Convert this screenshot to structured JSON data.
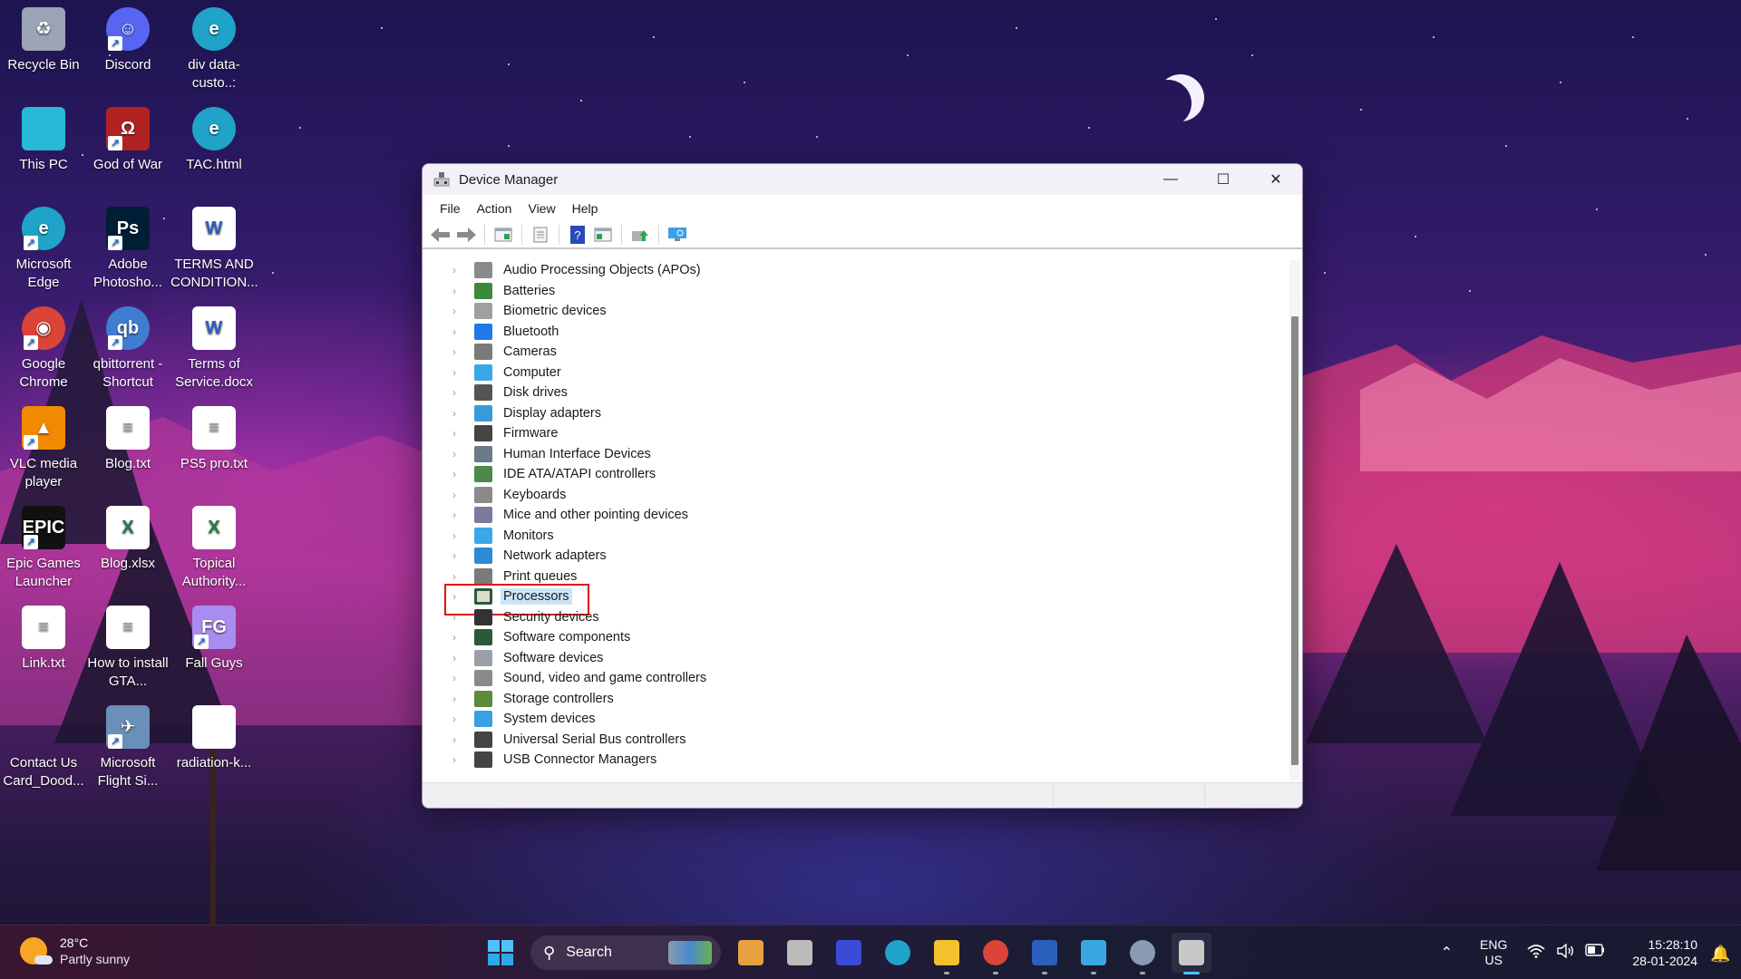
{
  "desktop": {
    "icons": [
      {
        "label": "Recycle Bin",
        "icon": "recycle-bin-icon",
        "color": "#9aa4b4",
        "glyph": "♻"
      },
      {
        "label": "Discord",
        "icon": "discord-icon",
        "color": "#5865f2",
        "glyph": "☺",
        "shortcut": true
      },
      {
        "label": "div data-custo..:",
        "icon": "edge-icon",
        "color": "#1fa3c8",
        "glyph": "e"
      },
      {
        "label": "This PC",
        "icon": "this-pc-icon",
        "color": "#28b8d8",
        "glyph": ""
      },
      {
        "label": "God of War",
        "icon": "god-of-war-icon",
        "color": "#b22222",
        "glyph": "Ω",
        "shortcut": true
      },
      {
        "label": "TAC.html",
        "icon": "edge-icon",
        "color": "#1fa3c8",
        "glyph": "e"
      },
      {
        "label": "Microsoft Edge",
        "icon": "edge-icon",
        "color": "#1fa3c8",
        "glyph": "e",
        "shortcut": true
      },
      {
        "label": "Adobe Photosho...",
        "icon": "photoshop-icon",
        "color": "#001e36",
        "glyph": "Ps",
        "shortcut": true
      },
      {
        "label": "TERMS AND CONDITION...",
        "icon": "word-doc-icon",
        "color": "#ffffff",
        "glyph": "W"
      },
      {
        "label": "Google Chrome",
        "icon": "chrome-icon",
        "color": "#db4437",
        "glyph": "◉",
        "shortcut": true
      },
      {
        "label": "qbittorrent - Shortcut",
        "icon": "qbittorrent-icon",
        "color": "#3f7dd0",
        "glyph": "qb",
        "shortcut": true
      },
      {
        "label": "Terms of Service.docx",
        "icon": "word-doc-icon",
        "color": "#ffffff",
        "glyph": "W"
      },
      {
        "label": "VLC media player",
        "icon": "vlc-icon",
        "color": "#f18a00",
        "glyph": "▲",
        "shortcut": true
      },
      {
        "label": "Blog.txt",
        "icon": "text-file-icon",
        "color": "#ffffff",
        "glyph": "≡"
      },
      {
        "label": "PS5 pro.txt",
        "icon": "text-file-icon",
        "color": "#ffffff",
        "glyph": "≡"
      },
      {
        "label": "Epic Games Launcher",
        "icon": "epic-games-icon",
        "color": "#111111",
        "glyph": "EPIC",
        "shortcut": true
      },
      {
        "label": "Blog.xlsx",
        "icon": "excel-file-icon",
        "color": "#ffffff",
        "glyph": "X"
      },
      {
        "label": "Topical Authority...",
        "icon": "excel-file-icon",
        "color": "#ffffff",
        "glyph": "X"
      },
      {
        "label": "Link.txt",
        "icon": "text-file-icon",
        "color": "#ffffff",
        "glyph": "≡"
      },
      {
        "label": "How to install GTA...",
        "icon": "text-file-icon",
        "color": "#ffffff",
        "glyph": "≡"
      },
      {
        "label": "Fall Guys",
        "icon": "fall-guys-icon",
        "color": "#a88cf0",
        "glyph": "FG",
        "shortcut": true
      },
      {
        "label": "Contact Us Card_Dood...",
        "icon": "image-file-icon",
        "color": "transparent",
        "glyph": ""
      },
      {
        "label": "Microsoft Flight Si...",
        "icon": "flight-simulator-icon",
        "color": "#6a8fb8",
        "glyph": "✈",
        "shortcut": true
      },
      {
        "label": "radiation-k...",
        "icon": "blank-file-icon",
        "color": "#ffffff",
        "glyph": ""
      }
    ]
  },
  "window": {
    "title": "Device Manager",
    "controls": {
      "minimize": "—",
      "maximize": "☐",
      "close": "✕"
    },
    "menu": [
      "File",
      "Action",
      "View",
      "Help"
    ],
    "toolbar": [
      "back",
      "forward",
      "show-hide-console-tree",
      "properties",
      "help",
      "show-action-pane",
      "update-driver",
      "scan-hardware"
    ],
    "tree": [
      {
        "label": "Audio Processing Objects (APOs)",
        "icon": "speaker-icon",
        "color": "#8a8a8a"
      },
      {
        "label": "Batteries",
        "icon": "battery-icon",
        "color": "#3a8a3a"
      },
      {
        "label": "Biometric devices",
        "icon": "fingerprint-icon",
        "color": "#a0a0a0"
      },
      {
        "label": "Bluetooth",
        "icon": "bluetooth-icon",
        "color": "#1e7ae6"
      },
      {
        "label": "Cameras",
        "icon": "webcam-icon",
        "color": "#7a7a7a"
      },
      {
        "label": "Computer",
        "icon": "monitor-icon",
        "color": "#3aa8e8"
      },
      {
        "label": "Disk drives",
        "icon": "disk-drive-icon",
        "color": "#555555"
      },
      {
        "label": "Display adapters",
        "icon": "display-adapter-icon",
        "color": "#3a9ad8"
      },
      {
        "label": "Firmware",
        "icon": "chip-icon",
        "color": "#444444"
      },
      {
        "label": "Human Interface Devices",
        "icon": "hid-icon",
        "color": "#6a7a8a"
      },
      {
        "label": "IDE ATA/ATAPI controllers",
        "icon": "ide-controller-icon",
        "color": "#4a8a4a"
      },
      {
        "label": "Keyboards",
        "icon": "keyboard-icon",
        "color": "#8a8a8a"
      },
      {
        "label": "Mice and other pointing devices",
        "icon": "mouse-icon",
        "color": "#7a7a9a"
      },
      {
        "label": "Monitors",
        "icon": "monitor-icon",
        "color": "#3aa8e8"
      },
      {
        "label": "Network adapters",
        "icon": "network-adapter-icon",
        "color": "#2a8ad8"
      },
      {
        "label": "Print queues",
        "icon": "printer-icon",
        "color": "#7a7a7a"
      },
      {
        "label": "Processors",
        "icon": "processor-icon",
        "color": "#3a6a4a",
        "selected": true
      },
      {
        "label": "Security devices",
        "icon": "security-device-icon",
        "color": "#333333"
      },
      {
        "label": "Software components",
        "icon": "software-component-icon",
        "color": "#2a5a3a"
      },
      {
        "label": "Software devices",
        "icon": "software-device-icon",
        "color": "#9aa0a8"
      },
      {
        "label": "Sound, video and game controllers",
        "icon": "speaker-icon",
        "color": "#8a8a8a"
      },
      {
        "label": "Storage controllers",
        "icon": "storage-controller-icon",
        "color": "#5a8a3a"
      },
      {
        "label": "System devices",
        "icon": "system-devices-icon",
        "color": "#3aa0e0"
      },
      {
        "label": "Universal Serial Bus controllers",
        "icon": "usb-icon",
        "color": "#444444"
      },
      {
        "label": "USB Connector Managers",
        "icon": "usb-icon",
        "color": "#444444"
      }
    ],
    "annotation_color": "#e01515"
  },
  "taskbar": {
    "weather": {
      "temp": "28°C",
      "condition": "Partly sunny"
    },
    "search_label": "Search",
    "apps": [
      {
        "name": "copilot-icon",
        "color": "#e8a040",
        "open": false
      },
      {
        "name": "task-view-icon",
        "color": "#bcbcbc",
        "open": false
      },
      {
        "name": "app-icon",
        "color": "#3b4bd8",
        "open": false
      },
      {
        "name": "edge-icon",
        "color": "#1fa3c8",
        "open": false
      },
      {
        "name": "file-explorer-icon",
        "color": "#f2c12e",
        "open": true
      },
      {
        "name": "chrome-icon",
        "color": "#db4437",
        "open": true
      },
      {
        "name": "word-icon",
        "color": "#2b5fbe",
        "open": true
      },
      {
        "name": "notepad-icon",
        "color": "#3aa8e0",
        "open": true
      },
      {
        "name": "settings-icon",
        "color": "#8a9ab0",
        "open": true
      },
      {
        "name": "device-manager-icon",
        "color": "#c8c8c8",
        "open": true,
        "active": true
      }
    ],
    "tray": {
      "language": "ENG",
      "region": "US",
      "time": "15:28:10",
      "date": "28-01-2024"
    }
  }
}
